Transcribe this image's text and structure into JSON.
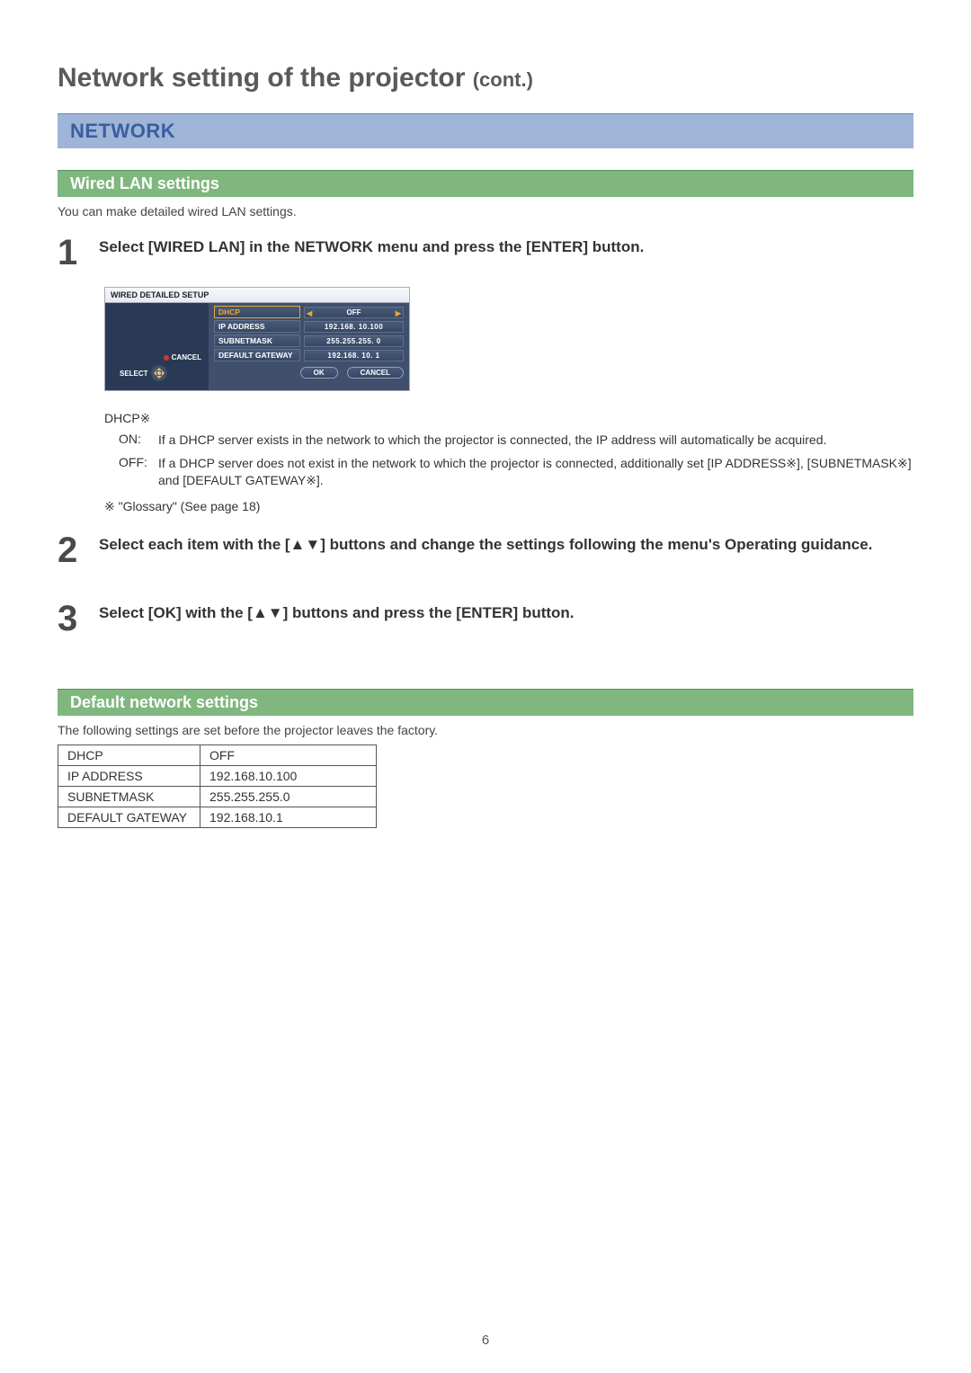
{
  "page_title_main": "Network setting of the projector",
  "page_title_cont": "(cont.)",
  "section_network": "NETWORK",
  "subsection_wired": "Wired LAN settings",
  "wired_intro": "You can make detailed wired LAN settings.",
  "step1": {
    "num": "1",
    "text": "Select [WIRED LAN] in the NETWORK menu and press the [ENTER] button."
  },
  "osd": {
    "title": "WIRED DETAILED SETUP",
    "cancel_label": "CANCEL",
    "select_label": "SELECT",
    "rows": [
      {
        "label": "DHCP",
        "value": "OFF",
        "selected": true,
        "arrows": true
      },
      {
        "label": "IP ADDRESS",
        "value": "192.168. 10.100"
      },
      {
        "label": "SUBNETMASK",
        "value": "255.255.255.  0"
      },
      {
        "label": "DEFAULT GATEWAY",
        "value": "192.168. 10.  1"
      }
    ],
    "ok": "OK",
    "cancel_btn": "CANCEL"
  },
  "dhcp_desc": {
    "head": "DHCP※",
    "on_key": "ON:",
    "on_val": "If a DHCP server exists in the network to which the projector is connected, the IP address will automatically be acquired.",
    "off_key": "OFF:",
    "off_val": "If a DHCP server does not exist in the network to which the projector is connected, additionally set [IP ADDRESS※], [SUBNETMASK※] and [DEFAULT GATEWAY※]."
  },
  "glossary_note": "※ \"Glossary\" (See page 18)",
  "step2": {
    "num": "2",
    "text": "Select each item with the [▲▼] buttons and change the settings following the menu's Operating guidance."
  },
  "step3": {
    "num": "3",
    "text": "Select [OK] with the [▲▼] buttons and press the [ENTER] button."
  },
  "subsection_default": "Default network settings",
  "default_intro": "The following settings are set before the projector leaves the factory.",
  "default_table": [
    {
      "k": "DHCP",
      "v": "OFF"
    },
    {
      "k": "IP ADDRESS",
      "v": "192.168.10.100"
    },
    {
      "k": "SUBNETMASK",
      "v": "255.255.255.0"
    },
    {
      "k": "DEFAULT GATEWAY",
      "v": "192.168.10.1"
    }
  ],
  "page_number": "6"
}
